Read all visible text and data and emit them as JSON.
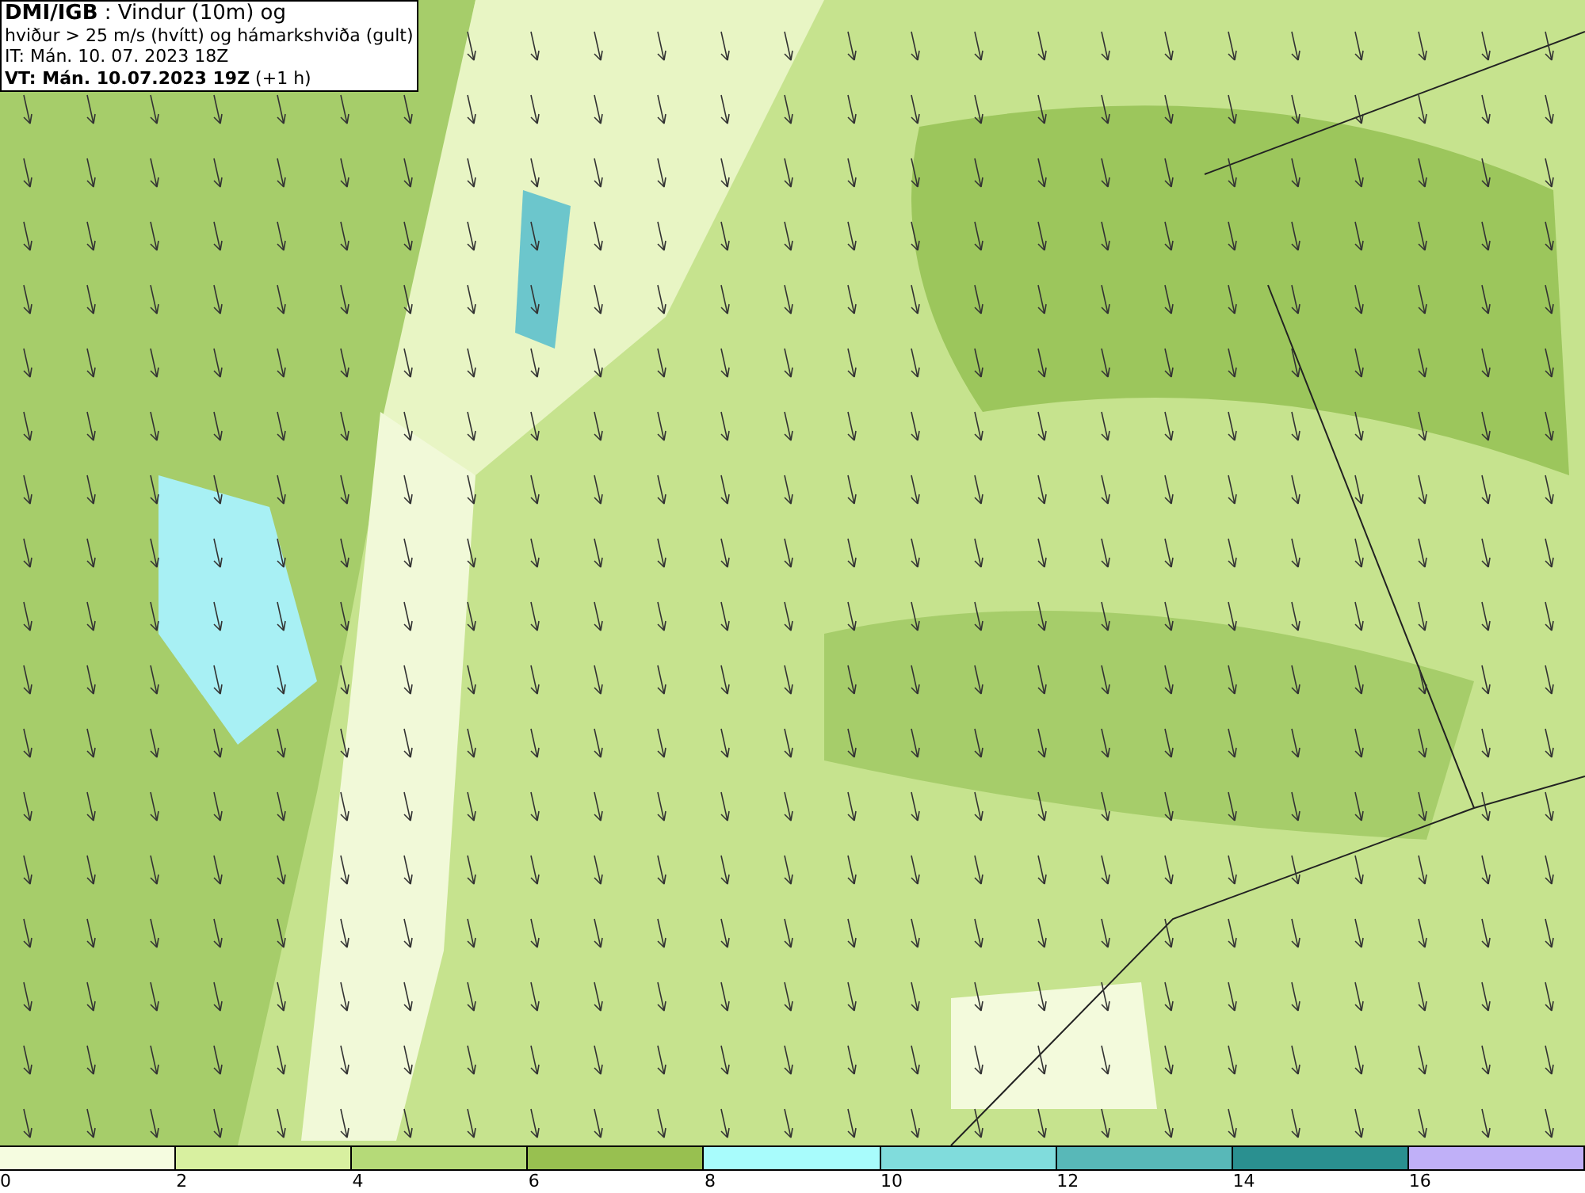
{
  "title_box": {
    "lines": [
      "**DMI/IGB** : Vindur (10m) og",
      "hviður > 25 m/s (hvítt) og hámarkshviða (gult)",
      "IT: Mán. 10. 07. 2023 18Z",
      "**VT: Mán. 10.07.2023 19Z** (+1 h)"
    ]
  },
  "legend": {
    "bins": [
      {
        "label": "0",
        "color": "#f5fce0"
      },
      {
        "label": "2",
        "color": "#d8f0a0"
      },
      {
        "label": "4",
        "color": "#b5da78"
      },
      {
        "label": "6",
        "color": "#98c050"
      },
      {
        "label": "8",
        "color": "#a8fcfc"
      },
      {
        "label": "10",
        "color": "#80dcdc"
      },
      {
        "label": "12",
        "color": "#58b8b8"
      },
      {
        "label": "14",
        "color": "#2a9090"
      },
      {
        "label": "16",
        "color": "#c0b0f8"
      }
    ]
  }
}
